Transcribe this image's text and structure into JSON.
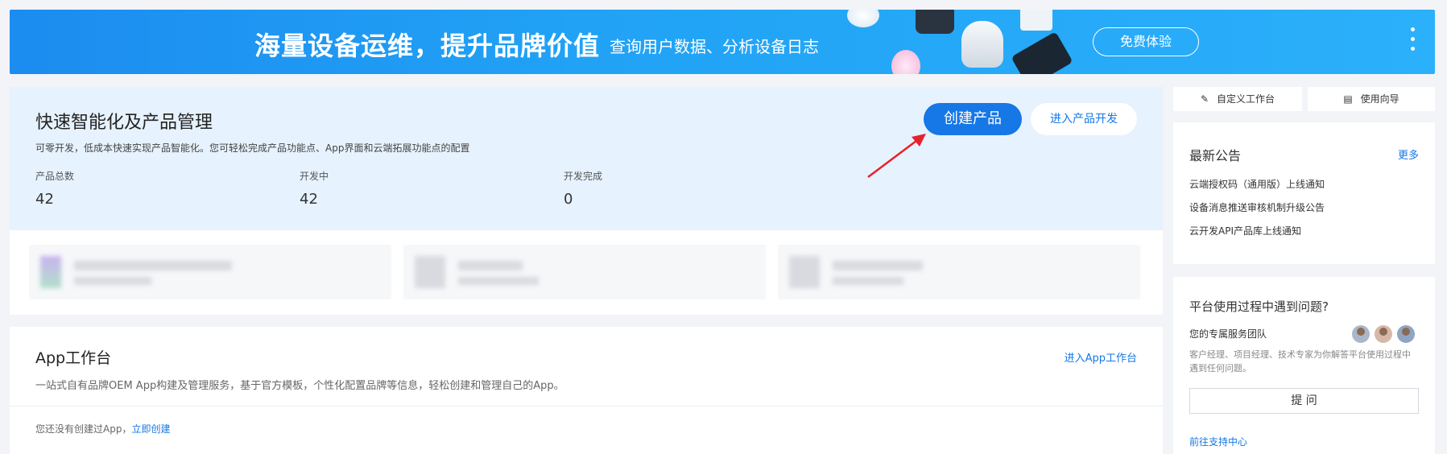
{
  "banner": {
    "title": "海量设备运维，提升品牌价值",
    "subtitle": "查询用户数据、分析设备日志",
    "cta_label": "免费体验"
  },
  "hero": {
    "title": "快速智能化及产品管理",
    "description": "可零开发，低成本快速实现产品智能化。您可轻松完成产品功能点、App界面和云端拓展功能点的配置",
    "create_label": "创建产品",
    "develop_label": "进入产品开发",
    "stats": [
      {
        "label": "产品总数",
        "value": "42"
      },
      {
        "label": "开发中",
        "value": "42"
      },
      {
        "label": "开发完成",
        "value": "0"
      }
    ]
  },
  "app": {
    "title": "App工作台",
    "description": "一站式自有品牌OEM App构建及管理服务，基于官方模板，个性化配置品牌等信息，轻松创建和管理自己的App。",
    "link_label": "进入App工作台",
    "empty_text": "您还没有创建过App，",
    "create_now_label": "立即创建"
  },
  "tools": {
    "custom_label": "自定义工作台",
    "guide_label": "使用向导"
  },
  "notices": {
    "title": "最新公告",
    "more_label": "更多",
    "items": [
      "云端授权码（通用版）上线通知",
      "设备消息推送审核机制升级公告",
      "云开发API产品库上线通知"
    ]
  },
  "help": {
    "title": "平台使用过程中遇到问题?",
    "team_label": "您的专属服务团队",
    "description": "客户经理、项目经理、技术专家为你解答平台使用过程中遇到任何问题。",
    "ask_label": "提 问",
    "support_label": "前往支持中心"
  },
  "colors": {
    "accent": "#1677e6",
    "banner": "#21a2f5",
    "hero_bg": "#e6f2fd",
    "arrow": "#e8212b"
  }
}
